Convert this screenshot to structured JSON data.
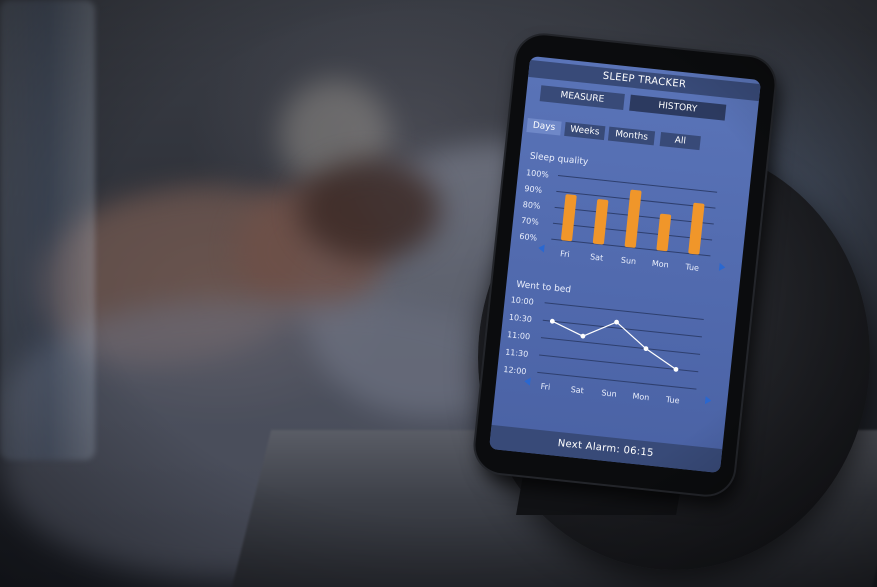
{
  "app": {
    "title": "SLEEP TRACKER",
    "modes": [
      "MEASURE",
      "HISTORY"
    ],
    "tabs": [
      "Days",
      "Weeks",
      "Months",
      "All"
    ],
    "alarm": "Next Alarm: 06:15"
  },
  "quality": {
    "label": "Sleep quality",
    "y_ticks": [
      "100%",
      "90%",
      "80%",
      "70%",
      "60%"
    ],
    "days": [
      "Fri",
      "Sat",
      "Sun",
      "Mon",
      "Tue"
    ],
    "values": [
      89,
      88,
      96,
      83,
      92
    ],
    "bar_color": "#f0962a"
  },
  "bed": {
    "label": "Went to bed",
    "y_ticks": [
      "10:00",
      "10:30",
      "11:00",
      "11:30",
      "12:00"
    ],
    "days": [
      "Fri",
      "Sat",
      "Sun",
      "Mon",
      "Tue"
    ],
    "times": [
      "10:30",
      "10:50",
      "10:20",
      "11:00",
      "11:30"
    ]
  },
  "colors": {
    "screen": "#5069ad",
    "banner": "#384a78",
    "arrow": "#2a68d0"
  }
}
